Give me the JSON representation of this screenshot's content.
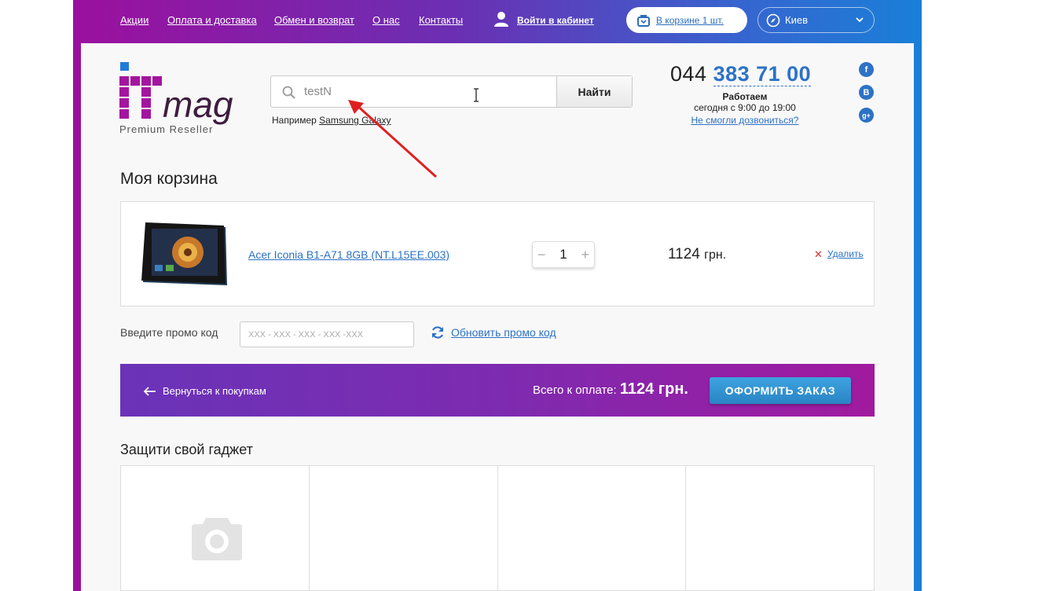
{
  "nav": {
    "links": [
      "Акции",
      "Оплата и доставка",
      "Обмен и возврат",
      "О нас",
      "Контакты"
    ],
    "login": "Войти в кабинет",
    "cart": "В корзине 1 шт.",
    "city": "Киев"
  },
  "logo": {
    "text": "ITmag",
    "subtitle": "Premium Reseller"
  },
  "search": {
    "value": "testN",
    "button": "Найти",
    "example_prefix": "Например",
    "example_link": "Samsung Galaxy"
  },
  "contact": {
    "phone_prefix": "044",
    "phone_number": "383 71 00",
    "hours_title": "Работаем",
    "hours": "сегодня с 9:00 до 19:00",
    "callback": "Не смогли дозвониться?",
    "socials": [
      "f",
      "B",
      "g+"
    ]
  },
  "cart": {
    "title": "Моя корзина",
    "item": {
      "name": "Acer Iconia B1-A71 8GB (NT.L15EE.003)",
      "qty": "1",
      "price": "1124",
      "currency": "грн.",
      "remove": "Удалить"
    }
  },
  "promo": {
    "label": "Введите промо код",
    "placeholder": "XXX - XXX - XXX - XXX -XXX",
    "refresh": "Обновить промо код"
  },
  "checkout": {
    "back": "Вернуться к покупкам",
    "total_label": "Всего к оплате:",
    "total_amount": "1124 грн.",
    "order_button": "ОФОРМИТЬ ЗАКАЗ"
  },
  "protect": {
    "title": "Защити свой гаджет"
  },
  "colors": {
    "brand_purple": "#9b109e",
    "brand_blue": "#2c72c6",
    "accent_red": "#e02020"
  }
}
